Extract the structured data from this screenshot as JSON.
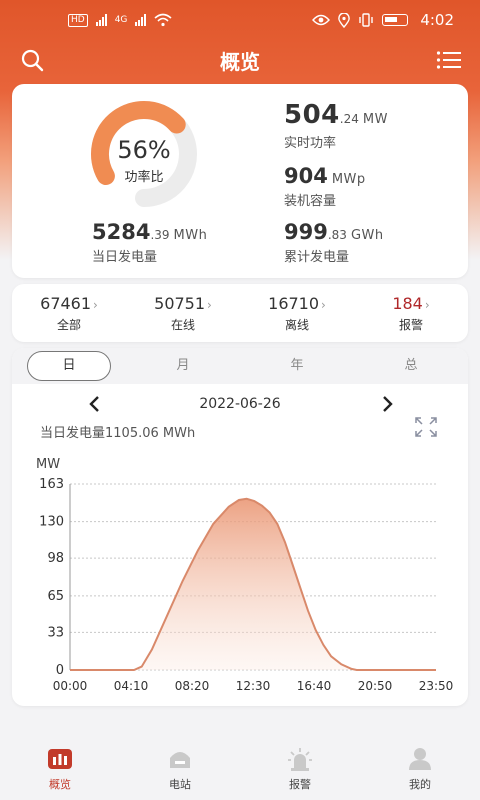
{
  "status_bar": {
    "network_badge": "HD",
    "net_type": "4G",
    "time": "4:02"
  },
  "header": {
    "title": "概览"
  },
  "power": {
    "ratio_percent": 56,
    "ratio_text": "56%",
    "ratio_label": "功率比",
    "realtime_power_int": "504",
    "realtime_power_frac": ".24",
    "realtime_power_unit": "MW",
    "realtime_power_label": "实时功率",
    "capacity_value": "904",
    "capacity_unit": "MWp",
    "capacity_label": "装机容量",
    "daily_gen_int": "5284",
    "daily_gen_frac": ".39",
    "daily_gen_unit": "MWh",
    "daily_gen_label": "当日发电量",
    "total_gen_int": "999",
    "total_gen_frac": ".83",
    "total_gen_unit": "GWh",
    "total_gen_label": "累计发电量"
  },
  "counts": [
    {
      "value": "67461",
      "label": "全部"
    },
    {
      "value": "50751",
      "label": "在线"
    },
    {
      "value": "16710",
      "label": "离线"
    },
    {
      "value": "184",
      "label": "报警"
    }
  ],
  "tabs": [
    "日",
    "月",
    "年",
    "总"
  ],
  "chart_header": {
    "date": "2022-06-26",
    "day_generation": "当日发电量1105.06 MWh"
  },
  "chart_data": {
    "type": "area",
    "ylabel": "MW",
    "yticks": [
      0,
      33,
      65,
      98,
      130,
      163
    ],
    "ylim": [
      0,
      163
    ],
    "xticks": [
      "00:00",
      "04:10",
      "08:20",
      "12:30",
      "16:40",
      "20:50",
      "23:50"
    ],
    "xlim": [
      0,
      1430
    ],
    "grid": true,
    "line_color": "#d9896a",
    "series": [
      {
        "x": [
          0,
          250,
          280,
          320,
          380,
          440,
          500,
          560,
          620,
          660,
          690,
          720,
          750,
          780,
          810,
          840,
          870,
          900,
          930,
          960,
          990,
          1020,
          1060,
          1100,
          1120,
          1430
        ],
        "y": [
          0,
          0,
          3,
          18,
          48,
          78,
          105,
          128,
          143,
          149,
          150,
          148,
          144,
          138,
          128,
          112,
          92,
          72,
          52,
          35,
          22,
          12,
          5,
          1,
          0,
          0
        ]
      }
    ]
  },
  "bottom_nav": [
    {
      "label": "概览"
    },
    {
      "label": "电站"
    },
    {
      "label": "报警"
    },
    {
      "label": "我的"
    }
  ],
  "colors": {
    "brand": "#e0562a",
    "gauge_fill": "#f08c52",
    "gauge_track": "#ececec",
    "alarm": "#b0282a",
    "nav_active": "#c23a2a"
  }
}
